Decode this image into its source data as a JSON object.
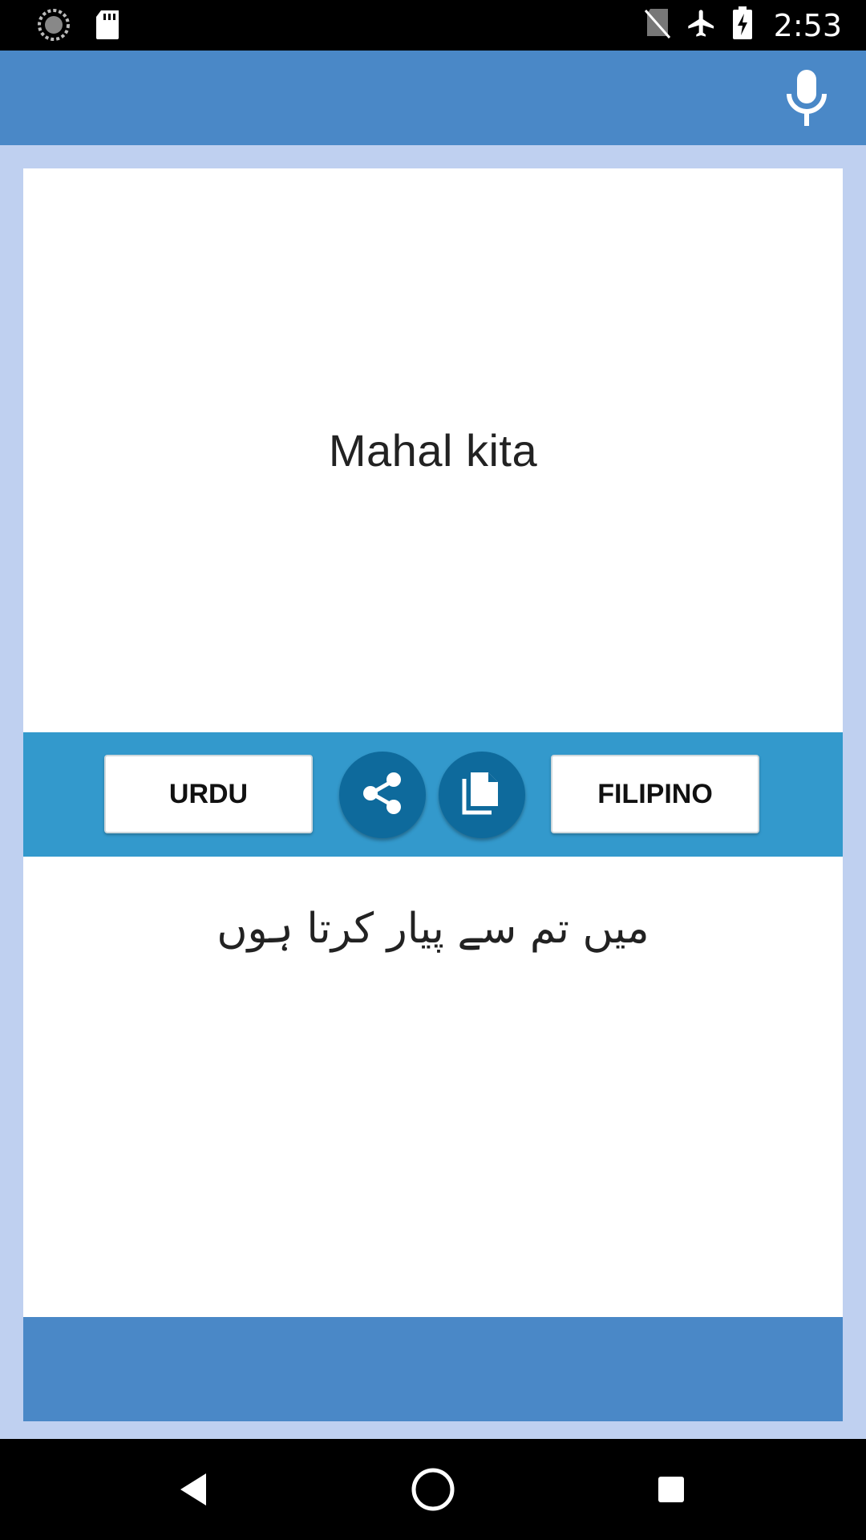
{
  "status_bar": {
    "time": "2:53",
    "icons": [
      "sync-icon",
      "sd-card-icon",
      "no-sim-icon",
      "airplane-icon",
      "battery-charging-icon"
    ]
  },
  "app_bar": {
    "mic_icon": "microphone-icon"
  },
  "translation": {
    "source_text": "Mahal kita",
    "target_text": "میں تم سے پیار کرتا ہوں"
  },
  "toolbar": {
    "left_language": "URDU",
    "right_language": "FILIPINO",
    "share_icon": "share-icon",
    "copy_icon": "copy-icon"
  },
  "nav_bar": {
    "icons": [
      "back-icon",
      "home-icon",
      "recents-icon"
    ]
  },
  "colors": {
    "app_bar": "#4a88c7",
    "background": "#bfd0f0",
    "toolbar": "#3399cc",
    "action_button": "#0e6a9c"
  }
}
